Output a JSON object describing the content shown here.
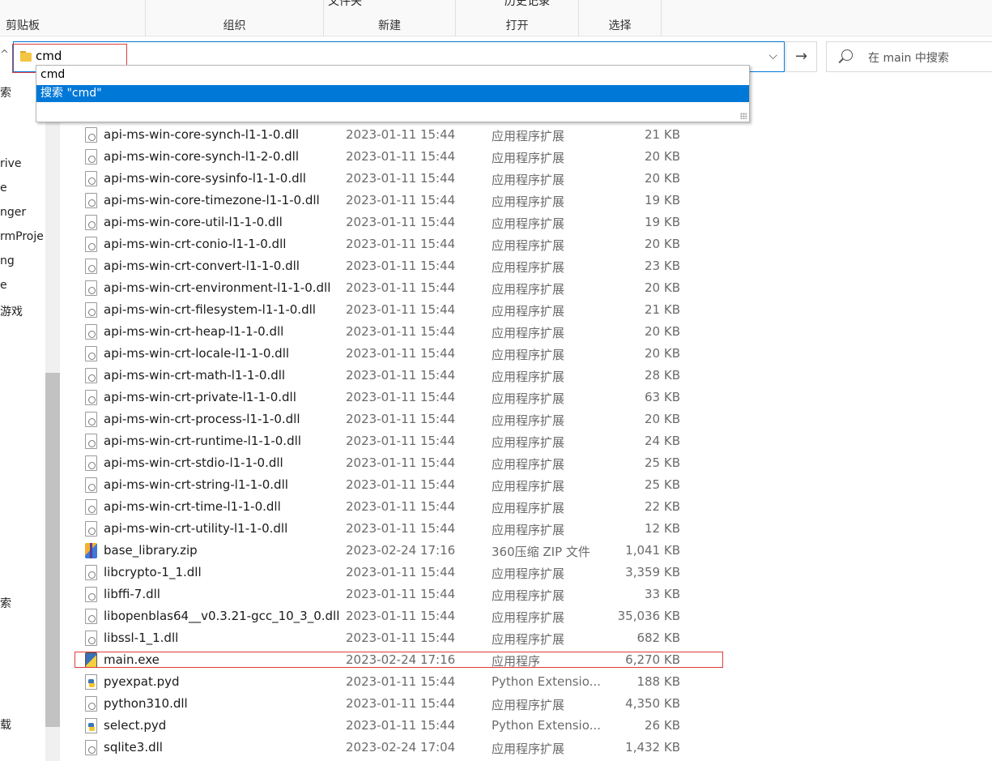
{
  "ribbon": {
    "clipboard": "剪贴板",
    "organize": "组织",
    "new": "新建",
    "new_top": "文件夹",
    "open": "打开",
    "open_top": "历史记录",
    "select": "选择"
  },
  "address": {
    "value": "cmd"
  },
  "suggestions": [
    "cmd",
    "搜索 \"cmd\""
  ],
  "search": {
    "placeholder": "在 main 中搜索"
  },
  "nav_items": [
    "索",
    "rive",
    "e",
    "nger",
    "rmProje",
    "ng",
    "e",
    "游戏",
    "索",
    "载"
  ],
  "files": [
    {
      "name": "api-ms-win-core-synch-l1-1-0.dll",
      "date": "2023-01-11 15:44",
      "type": "应用程序扩展",
      "size": "21 KB",
      "icon": "dll-icon"
    },
    {
      "name": "api-ms-win-core-synch-l1-2-0.dll",
      "date": "2023-01-11 15:44",
      "type": "应用程序扩展",
      "size": "20 KB",
      "icon": "dll-icon"
    },
    {
      "name": "api-ms-win-core-sysinfo-l1-1-0.dll",
      "date": "2023-01-11 15:44",
      "type": "应用程序扩展",
      "size": "20 KB",
      "icon": "dll-icon"
    },
    {
      "name": "api-ms-win-core-timezone-l1-1-0.dll",
      "date": "2023-01-11 15:44",
      "type": "应用程序扩展",
      "size": "19 KB",
      "icon": "dll-icon"
    },
    {
      "name": "api-ms-win-core-util-l1-1-0.dll",
      "date": "2023-01-11 15:44",
      "type": "应用程序扩展",
      "size": "19 KB",
      "icon": "dll-icon"
    },
    {
      "name": "api-ms-win-crt-conio-l1-1-0.dll",
      "date": "2023-01-11 15:44",
      "type": "应用程序扩展",
      "size": "20 KB",
      "icon": "dll-icon"
    },
    {
      "name": "api-ms-win-crt-convert-l1-1-0.dll",
      "date": "2023-01-11 15:44",
      "type": "应用程序扩展",
      "size": "23 KB",
      "icon": "dll-icon"
    },
    {
      "name": "api-ms-win-crt-environment-l1-1-0.dll",
      "date": "2023-01-11 15:44",
      "type": "应用程序扩展",
      "size": "20 KB",
      "icon": "dll-icon"
    },
    {
      "name": "api-ms-win-crt-filesystem-l1-1-0.dll",
      "date": "2023-01-11 15:44",
      "type": "应用程序扩展",
      "size": "21 KB",
      "icon": "dll-icon"
    },
    {
      "name": "api-ms-win-crt-heap-l1-1-0.dll",
      "date": "2023-01-11 15:44",
      "type": "应用程序扩展",
      "size": "20 KB",
      "icon": "dll-icon"
    },
    {
      "name": "api-ms-win-crt-locale-l1-1-0.dll",
      "date": "2023-01-11 15:44",
      "type": "应用程序扩展",
      "size": "20 KB",
      "icon": "dll-icon"
    },
    {
      "name": "api-ms-win-crt-math-l1-1-0.dll",
      "date": "2023-01-11 15:44",
      "type": "应用程序扩展",
      "size": "28 KB",
      "icon": "dll-icon"
    },
    {
      "name": "api-ms-win-crt-private-l1-1-0.dll",
      "date": "2023-01-11 15:44",
      "type": "应用程序扩展",
      "size": "63 KB",
      "icon": "dll-icon"
    },
    {
      "name": "api-ms-win-crt-process-l1-1-0.dll",
      "date": "2023-01-11 15:44",
      "type": "应用程序扩展",
      "size": "20 KB",
      "icon": "dll-icon"
    },
    {
      "name": "api-ms-win-crt-runtime-l1-1-0.dll",
      "date": "2023-01-11 15:44",
      "type": "应用程序扩展",
      "size": "24 KB",
      "icon": "dll-icon"
    },
    {
      "name": "api-ms-win-crt-stdio-l1-1-0.dll",
      "date": "2023-01-11 15:44",
      "type": "应用程序扩展",
      "size": "25 KB",
      "icon": "dll-icon"
    },
    {
      "name": "api-ms-win-crt-string-l1-1-0.dll",
      "date": "2023-01-11 15:44",
      "type": "应用程序扩展",
      "size": "25 KB",
      "icon": "dll-icon"
    },
    {
      "name": "api-ms-win-crt-time-l1-1-0.dll",
      "date": "2023-01-11 15:44",
      "type": "应用程序扩展",
      "size": "22 KB",
      "icon": "dll-icon"
    },
    {
      "name": "api-ms-win-crt-utility-l1-1-0.dll",
      "date": "2023-01-11 15:44",
      "type": "应用程序扩展",
      "size": "12 KB",
      "icon": "dll-icon"
    },
    {
      "name": "base_library.zip",
      "date": "2023-02-24 17:16",
      "type": "360压缩 ZIP 文件",
      "size": "1,041 KB",
      "icon": "zip-archive-icon"
    },
    {
      "name": "libcrypto-1_1.dll",
      "date": "2023-01-11 15:44",
      "type": "应用程序扩展",
      "size": "3,359 KB",
      "icon": "dll-icon"
    },
    {
      "name": "libffi-7.dll",
      "date": "2023-01-11 15:44",
      "type": "应用程序扩展",
      "size": "33 KB",
      "icon": "dll-icon"
    },
    {
      "name": "libopenblas64__v0.3.21-gcc_10_3_0.dll",
      "date": "2023-01-11 15:44",
      "type": "应用程序扩展",
      "size": "35,036 KB",
      "icon": "dll-icon"
    },
    {
      "name": "libssl-1_1.dll",
      "date": "2023-01-11 15:44",
      "type": "应用程序扩展",
      "size": "682 KB",
      "icon": "dll-icon"
    },
    {
      "name": "main.exe",
      "date": "2023-02-24 17:16",
      "type": "应用程序",
      "size": "6,270 KB",
      "icon": "exe-icon"
    },
    {
      "name": "pyexpat.pyd",
      "date": "2023-01-11 15:44",
      "type": "Python Extensio...",
      "size": "188 KB",
      "icon": "python-file-icon"
    },
    {
      "name": "python310.dll",
      "date": "2023-01-11 15:44",
      "type": "应用程序扩展",
      "size": "4,350 KB",
      "icon": "dll-icon"
    },
    {
      "name": "select.pyd",
      "date": "2023-01-11 15:44",
      "type": "Python Extensio...",
      "size": "26 KB",
      "icon": "python-file-icon"
    },
    {
      "name": "sqlite3.dll",
      "date": "2023-02-24 17:04",
      "type": "应用程序扩展",
      "size": "1,432 KB",
      "icon": "dll-icon"
    }
  ],
  "colors": {
    "accent": "#0078d7",
    "highlight_box": "#e03c3c",
    "secondary_text": "#6b6b6b"
  }
}
